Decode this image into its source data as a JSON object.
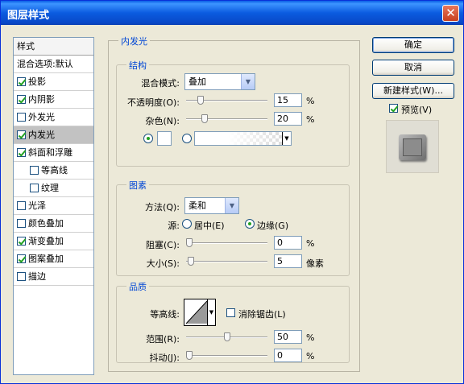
{
  "window": {
    "title": "图层样式",
    "close_symbol": "✕"
  },
  "style_list": {
    "header": "样式",
    "items": [
      {
        "label": "混合选项:默认",
        "checkbox": false
      },
      {
        "label": "投影",
        "checkbox": true,
        "checked": true
      },
      {
        "label": "内阴影",
        "checkbox": true,
        "checked": true
      },
      {
        "label": "外发光",
        "checkbox": true,
        "checked": false
      },
      {
        "label": "内发光",
        "checkbox": true,
        "checked": true,
        "selected": true
      },
      {
        "label": "斜面和浮雕",
        "checkbox": true,
        "checked": true
      },
      {
        "label": "等高线",
        "checkbox": true,
        "checked": false,
        "sub": true
      },
      {
        "label": "纹理",
        "checkbox": true,
        "checked": false,
        "sub": true
      },
      {
        "label": "光泽",
        "checkbox": true,
        "checked": false
      },
      {
        "label": "颜色叠加",
        "checkbox": true,
        "checked": false
      },
      {
        "label": "渐变叠加",
        "checkbox": true,
        "checked": true
      },
      {
        "label": "图案叠加",
        "checkbox": true,
        "checked": true
      },
      {
        "label": "描边",
        "checkbox": true,
        "checked": false
      }
    ]
  },
  "inner_glow": {
    "title": "内发光",
    "structure": {
      "title": "结构",
      "blend_mode_label": "混合模式:",
      "blend_mode_value": "叠加",
      "opacity_label": "不透明度(O):",
      "opacity_value": "15",
      "opacity_unit": "%",
      "opacity_level": 0.15,
      "noise_label": "杂色(N):",
      "noise_value": "20",
      "noise_unit": "%",
      "noise_level": 0.2
    },
    "elements": {
      "title": "图素",
      "method_label": "方法(Q):",
      "method_value": "柔和",
      "source_label": "源:",
      "source_center": "居中(E)",
      "source_edge": "边缘(G)",
      "choke_label": "阻塞(C):",
      "choke_value": "0",
      "choke_unit": "%",
      "choke_level": 0,
      "size_label": "大小(S):",
      "size_value": "5",
      "size_unit": "像素",
      "size_level": 0.02
    },
    "quality": {
      "title": "品质",
      "contour_label": "等高线:",
      "antialias_label": "消除锯齿(L)",
      "range_label": "范围(R):",
      "range_value": "50",
      "range_unit": "%",
      "range_level": 0.5,
      "jitter_label": "抖动(J):",
      "jitter_value": "0",
      "jitter_unit": "%",
      "jitter_level": 0
    }
  },
  "buttons": {
    "ok": "确定",
    "cancel": "取消",
    "new_style": "新建样式(W)...",
    "preview": "预览(V)"
  }
}
